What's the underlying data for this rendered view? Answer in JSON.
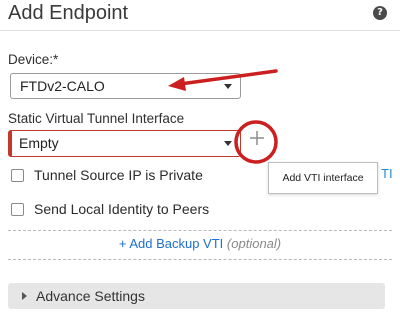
{
  "header": {
    "title": "Add Endpoint",
    "help_icon": "help-circle-icon",
    "help_glyph": "?"
  },
  "device": {
    "label": "Device:*",
    "value": "FTDv2-CALO"
  },
  "svti": {
    "label": "Static Virtual Tunnel Interface",
    "value": "Empty",
    "add_icon": "plus-icon"
  },
  "tooltip": {
    "text": "Add VTI interface"
  },
  "options": {
    "tunnel_private": {
      "label": "Tunnel Source IP is Private",
      "checked": false
    },
    "send_identity": {
      "label": "Send Local Identity to Peers",
      "checked": false
    },
    "partial_text": "TI"
  },
  "backup": {
    "link": "+ Add Backup VTI",
    "optional": "(optional)"
  },
  "advance": {
    "label": "Advance Settings"
  },
  "colors": {
    "annotation": "#cc1f1f",
    "link": "#1e6fcf",
    "required_border": "#c0392b"
  }
}
